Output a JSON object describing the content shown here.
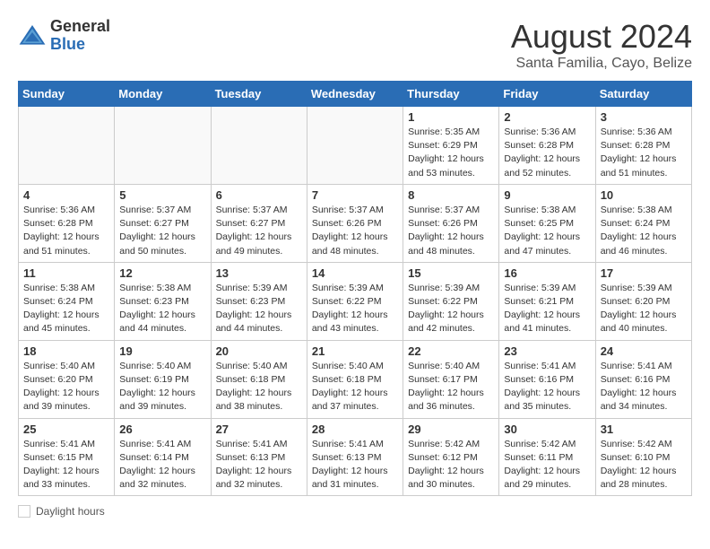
{
  "logo": {
    "general": "General",
    "blue": "Blue"
  },
  "title": "August 2024",
  "location": "Santa Familia, Cayo, Belize",
  "days_of_week": [
    "Sunday",
    "Monday",
    "Tuesday",
    "Wednesday",
    "Thursday",
    "Friday",
    "Saturday"
  ],
  "footer_label": "Daylight hours",
  "weeks": [
    [
      {
        "day": "",
        "info": ""
      },
      {
        "day": "",
        "info": ""
      },
      {
        "day": "",
        "info": ""
      },
      {
        "day": "",
        "info": ""
      },
      {
        "day": "1",
        "info": "Sunrise: 5:35 AM\nSunset: 6:29 PM\nDaylight: 12 hours\nand 53 minutes."
      },
      {
        "day": "2",
        "info": "Sunrise: 5:36 AM\nSunset: 6:28 PM\nDaylight: 12 hours\nand 52 minutes."
      },
      {
        "day": "3",
        "info": "Sunrise: 5:36 AM\nSunset: 6:28 PM\nDaylight: 12 hours\nand 51 minutes."
      }
    ],
    [
      {
        "day": "4",
        "info": "Sunrise: 5:36 AM\nSunset: 6:28 PM\nDaylight: 12 hours\nand 51 minutes."
      },
      {
        "day": "5",
        "info": "Sunrise: 5:37 AM\nSunset: 6:27 PM\nDaylight: 12 hours\nand 50 minutes."
      },
      {
        "day": "6",
        "info": "Sunrise: 5:37 AM\nSunset: 6:27 PM\nDaylight: 12 hours\nand 49 minutes."
      },
      {
        "day": "7",
        "info": "Sunrise: 5:37 AM\nSunset: 6:26 PM\nDaylight: 12 hours\nand 48 minutes."
      },
      {
        "day": "8",
        "info": "Sunrise: 5:37 AM\nSunset: 6:26 PM\nDaylight: 12 hours\nand 48 minutes."
      },
      {
        "day": "9",
        "info": "Sunrise: 5:38 AM\nSunset: 6:25 PM\nDaylight: 12 hours\nand 47 minutes."
      },
      {
        "day": "10",
        "info": "Sunrise: 5:38 AM\nSunset: 6:24 PM\nDaylight: 12 hours\nand 46 minutes."
      }
    ],
    [
      {
        "day": "11",
        "info": "Sunrise: 5:38 AM\nSunset: 6:24 PM\nDaylight: 12 hours\nand 45 minutes."
      },
      {
        "day": "12",
        "info": "Sunrise: 5:38 AM\nSunset: 6:23 PM\nDaylight: 12 hours\nand 44 minutes."
      },
      {
        "day": "13",
        "info": "Sunrise: 5:39 AM\nSunset: 6:23 PM\nDaylight: 12 hours\nand 44 minutes."
      },
      {
        "day": "14",
        "info": "Sunrise: 5:39 AM\nSunset: 6:22 PM\nDaylight: 12 hours\nand 43 minutes."
      },
      {
        "day": "15",
        "info": "Sunrise: 5:39 AM\nSunset: 6:22 PM\nDaylight: 12 hours\nand 42 minutes."
      },
      {
        "day": "16",
        "info": "Sunrise: 5:39 AM\nSunset: 6:21 PM\nDaylight: 12 hours\nand 41 minutes."
      },
      {
        "day": "17",
        "info": "Sunrise: 5:39 AM\nSunset: 6:20 PM\nDaylight: 12 hours\nand 40 minutes."
      }
    ],
    [
      {
        "day": "18",
        "info": "Sunrise: 5:40 AM\nSunset: 6:20 PM\nDaylight: 12 hours\nand 39 minutes."
      },
      {
        "day": "19",
        "info": "Sunrise: 5:40 AM\nSunset: 6:19 PM\nDaylight: 12 hours\nand 39 minutes."
      },
      {
        "day": "20",
        "info": "Sunrise: 5:40 AM\nSunset: 6:18 PM\nDaylight: 12 hours\nand 38 minutes."
      },
      {
        "day": "21",
        "info": "Sunrise: 5:40 AM\nSunset: 6:18 PM\nDaylight: 12 hours\nand 37 minutes."
      },
      {
        "day": "22",
        "info": "Sunrise: 5:40 AM\nSunset: 6:17 PM\nDaylight: 12 hours\nand 36 minutes."
      },
      {
        "day": "23",
        "info": "Sunrise: 5:41 AM\nSunset: 6:16 PM\nDaylight: 12 hours\nand 35 minutes."
      },
      {
        "day": "24",
        "info": "Sunrise: 5:41 AM\nSunset: 6:16 PM\nDaylight: 12 hours\nand 34 minutes."
      }
    ],
    [
      {
        "day": "25",
        "info": "Sunrise: 5:41 AM\nSunset: 6:15 PM\nDaylight: 12 hours\nand 33 minutes."
      },
      {
        "day": "26",
        "info": "Sunrise: 5:41 AM\nSunset: 6:14 PM\nDaylight: 12 hours\nand 32 minutes."
      },
      {
        "day": "27",
        "info": "Sunrise: 5:41 AM\nSunset: 6:13 PM\nDaylight: 12 hours\nand 32 minutes."
      },
      {
        "day": "28",
        "info": "Sunrise: 5:41 AM\nSunset: 6:13 PM\nDaylight: 12 hours\nand 31 minutes."
      },
      {
        "day": "29",
        "info": "Sunrise: 5:42 AM\nSunset: 6:12 PM\nDaylight: 12 hours\nand 30 minutes."
      },
      {
        "day": "30",
        "info": "Sunrise: 5:42 AM\nSunset: 6:11 PM\nDaylight: 12 hours\nand 29 minutes."
      },
      {
        "day": "31",
        "info": "Sunrise: 5:42 AM\nSunset: 6:10 PM\nDaylight: 12 hours\nand 28 minutes."
      }
    ]
  ]
}
